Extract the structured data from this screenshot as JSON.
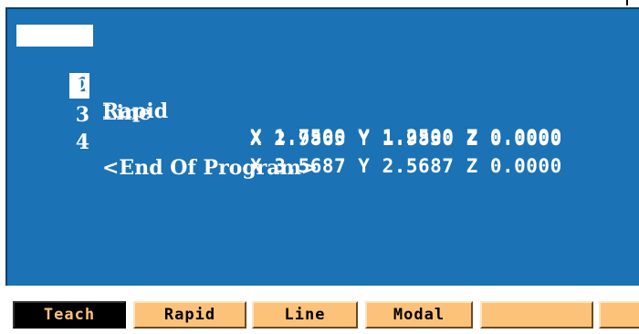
{
  "program": {
    "lines": [
      {
        "num": "1",
        "command": "Rapid",
        "coords": "X 1.7500 Y 1.2500 Z 0.0000"
      },
      {
        "num": "2",
        "command": "Line",
        "coords": "X 2.9865 Y 1.9830 Z 0.0000"
      },
      {
        "num": "3",
        "command": "",
        "coords": "X 3.5687 Y 2.5687 Z 0.0000"
      },
      {
        "num": "4",
        "command": "<End Of Program>",
        "coords": ""
      }
    ],
    "selected_line": "1"
  },
  "softkeys": [
    {
      "label": "Teach",
      "active": true
    },
    {
      "label": "Rapid",
      "active": false
    },
    {
      "label": "Line",
      "active": false
    },
    {
      "label": "Modal",
      "active": false
    },
    {
      "label": "",
      "active": false
    },
    {
      "label": "",
      "active": false
    }
  ],
  "colors": {
    "panel_bg": "#1b72b4",
    "text": "#ffffff",
    "softkey_bg": "#fcc27a",
    "softkey_active_bg": "#000000"
  }
}
